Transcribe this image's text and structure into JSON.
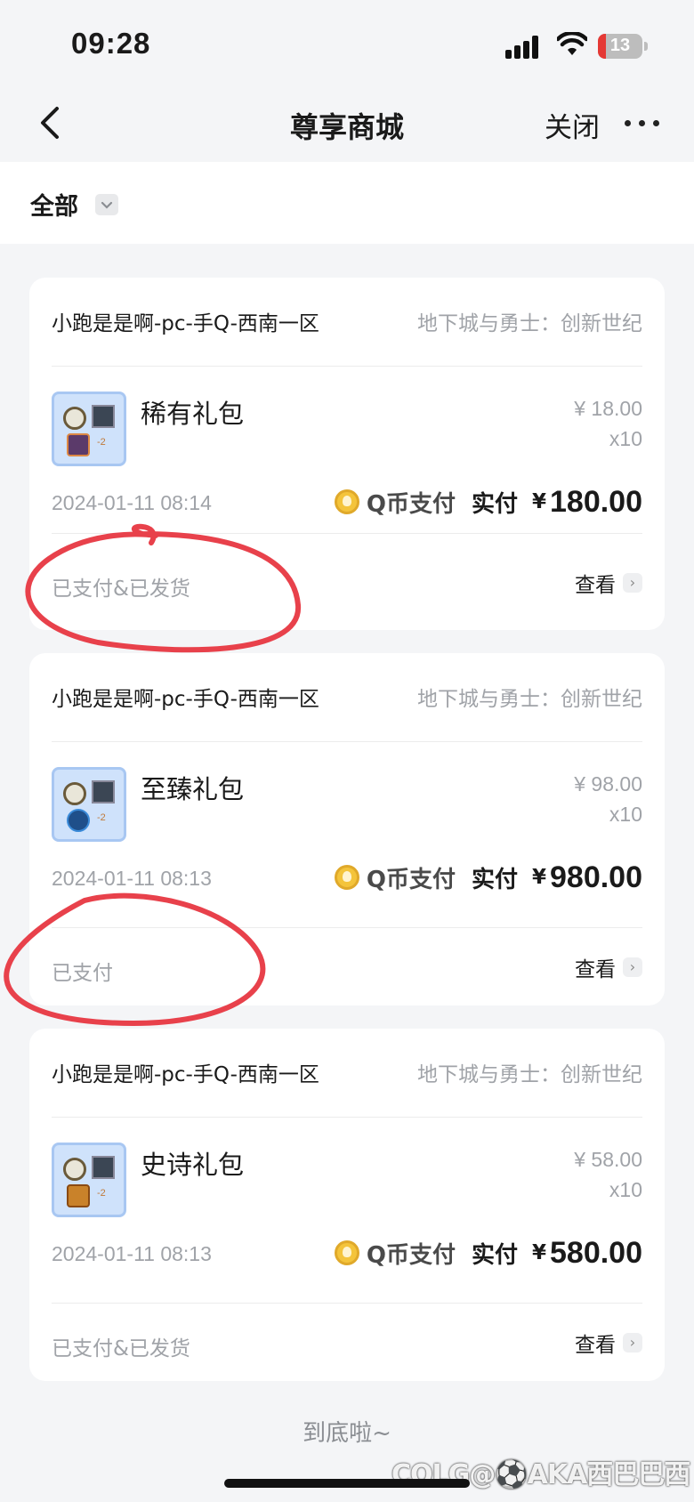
{
  "status_bar": {
    "time": "09:28",
    "battery": "13",
    "icons": [
      "cellular-signal-icon",
      "wifi-icon",
      "battery-icon"
    ]
  },
  "nav": {
    "back_icon": "chevron-left-icon",
    "title": "尊享商城",
    "close_label": "关闭",
    "more_icon": "more-dots-icon"
  },
  "filter": {
    "selected": "全部",
    "chevron_icon": "chevron-down-icon"
  },
  "orders": [
    {
      "shop": "小跑是是啊-pc-手Q-西南一区",
      "game": "地下城与勇士：创新世纪",
      "item_name": "稀有礼包",
      "unit_price": "¥ 18.00",
      "quantity": "x10",
      "time": "2024-01-11 08:14",
      "pay_method": "Q币支付",
      "paid_label": "实付",
      "currency": "¥",
      "amount": "180.00",
      "status": "已支付&已发货",
      "view_label": "查看"
    },
    {
      "shop": "小跑是是啊-pc-手Q-西南一区",
      "game": "地下城与勇士：创新世纪",
      "item_name": "至臻礼包",
      "unit_price": "¥ 98.00",
      "quantity": "x10",
      "time": "2024-01-11 08:13",
      "pay_method": "Q币支付",
      "paid_label": "实付",
      "currency": "¥",
      "amount": "980.00",
      "status": "已支付",
      "view_label": "查看"
    },
    {
      "shop": "小跑是是啊-pc-手Q-西南一区",
      "game": "地下城与勇士：创新世纪",
      "item_name": "史诗礼包",
      "unit_price": "¥ 58.00",
      "quantity": "x10",
      "time": "2024-01-11 08:13",
      "pay_method": "Q币支付",
      "paid_label": "实付",
      "currency": "¥",
      "amount": "580.00",
      "status": "已支付&已发货",
      "view_label": "查看"
    }
  ],
  "footer": {
    "end_text": "到底啦~",
    "watermark": "COLG@⚽AKA西巴巴西"
  },
  "colors": {
    "background": "#f4f5f7",
    "card": "#ffffff",
    "muted_text": "#a0a3a8",
    "coin": "#f4c43b",
    "annotation": "#e8414b"
  }
}
